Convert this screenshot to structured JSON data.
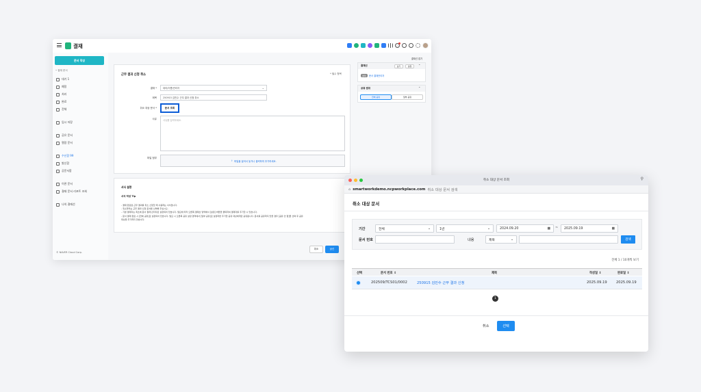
{
  "main_window": {
    "app_title": "결재",
    "sidebar": {
      "write_button": "문서 작성",
      "group_label": "• 결재 문서",
      "items": [
        {
          "label": "대기 1"
        },
        {
          "label": "예정"
        },
        {
          "label": "처리"
        },
        {
          "label": "완료"
        },
        {
          "label": "전체"
        },
        {
          "label": "임시 저장"
        },
        {
          "label": "공유 문서"
        },
        {
          "label": "열람 문서"
        },
        {
          "label": "수신함 99"
        },
        {
          "label": "발신함"
        },
        {
          "label": "공문서함"
        },
        {
          "label": "이관 문서"
        },
        {
          "label": "결재 문서 리포트 조회"
        },
        {
          "label": "나의 결재선"
        }
      ],
      "footer": "© NAVER Cloud Corp."
    },
    "form": {
      "title": "근무 결과 신청 취소",
      "required_note": "* 필수 항목",
      "doc_type_label": "결재 *",
      "doc_type_value": "대리/이름/관리자",
      "subject_label": "제목",
      "subject_value": "250915 김민수 근무 결과 신청 취소",
      "target_label": "취소 대상 문서 *",
      "target_button": "문서 조회",
      "reason_label": "사유",
      "reason_placeholder": "사유를 입력하세요.",
      "attach_label": "파일 첨부",
      "attach_text": "파일을 끌어서 놓거나 클릭하여 추가하세요."
    },
    "description": {
      "title": "서식 설명",
      "subtitle": "서식 작성 Tip",
      "lines": [
        "- 결재 완료된 근무 결과를 취소 신청할 때 사용하는 서식입니다.",
        "- 취소하려는 근무 결과 신청 문서를 선택해 주십시오.",
        "- 기본 결재자는 최초에 문서 결재 관리자로 설정되어 있습니다. 필요에 따라 오른쪽 결재선 영역에서 [설정] 버튼을 클릭하여 결재자를 추가할 수 있습니다.",
        "- 문서 결재 완료 시 [전체 공유]로 설정되어 있습니다. 필요 시 오른쪽 공유 설정 영역에서 [일부 공유]로 설정하면 추가한 공유 대상에게만 공유됩니다. 문서를 공유하지 않을 경우 [공유 안 함]을 선택 후 공유",
        "대상을 추가하지 않습니다."
      ]
    },
    "footer_buttons": {
      "cancel": "취소",
      "submit": "상신"
    },
    "right_panel": {
      "collapse_label": "결재선 접기",
      "approval_title": "결재선",
      "approval_btn1": "보기",
      "approval_btn2": "설정",
      "approver_tag": "결재",
      "approver_name": "문서 결재관리자",
      "share_title": "공유 범위",
      "share_opt1": "전체 공유",
      "share_opt2": "일부 공유"
    }
  },
  "dialog": {
    "window_title": "취소 대상 문서 조회",
    "url_domain": "smartworkdemo.ncpworkplace.com",
    "url_title": "취소 대상 문서 검색",
    "heading": "취소 대상 문서",
    "filters": {
      "period_label": "기간",
      "period_value": "전체",
      "range_value": "1년",
      "date_from": "2024.09.20",
      "date_sep": "~",
      "date_to": "2025.09.19",
      "docno_label": "문서 번호",
      "content_label": "내용",
      "content_value": "제목",
      "search_button": "검색"
    },
    "results_summary": "전체 1 / 10개씩 보기",
    "table": {
      "headers": {
        "select": "선택",
        "docno": "문서 번호 ⇕",
        "subject": "제목",
        "created": "작성일 ⇕",
        "completed": "완료일 ⇕"
      },
      "rows": [
        {
          "docno": "202509/TCS01/0002",
          "subject": "250915 김민수 근무 결과 신청",
          "created": "2025.09.19",
          "completed": "2025.09.19"
        }
      ]
    },
    "page": "1",
    "buttons": {
      "cancel": "취소",
      "confirm": "선택"
    }
  },
  "colors": {
    "accent": "#1f8cf0",
    "teal": "#1fb6c5",
    "highlight": "#0a5bd6"
  }
}
